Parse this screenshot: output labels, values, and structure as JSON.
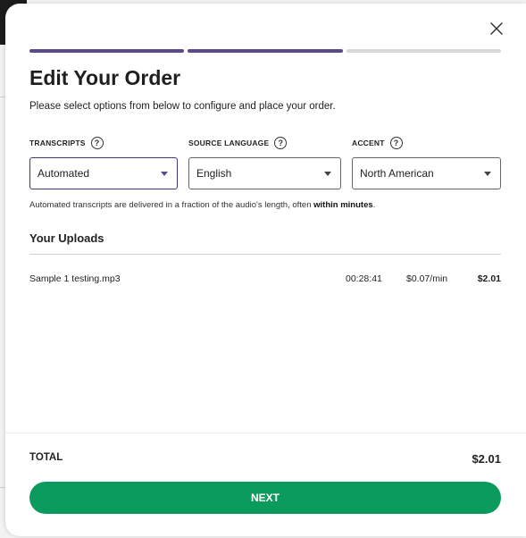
{
  "modal": {
    "title": "Edit Your Order",
    "subtitle": "Please select options from below to configure and place your order.",
    "progress": {
      "total_steps": 3,
      "completed_steps": 2
    }
  },
  "fields": {
    "transcripts": {
      "label": "TRANSCRIPTS",
      "value": "Automated"
    },
    "source_language": {
      "label": "SOURCE LANGUAGE",
      "value": "English"
    },
    "accent": {
      "label": "ACCENT",
      "value": "North American"
    }
  },
  "note": {
    "text": "Automated transcripts are delivered in a fraction of the audio's length, often ",
    "emphasis": "within minutes",
    "end": "."
  },
  "uploads": {
    "heading": "Your Uploads",
    "items": [
      {
        "name": "Sample 1 testing.mp3",
        "duration": "00:28:41",
        "rate": "$0.07/min",
        "price": "$2.01"
      }
    ]
  },
  "footer": {
    "total_label": "TOTAL",
    "total_value": "$2.01",
    "next_label": "NEXT"
  },
  "colors": {
    "accent": "#5a4a8c",
    "primary_button": "#0b9a5e"
  }
}
